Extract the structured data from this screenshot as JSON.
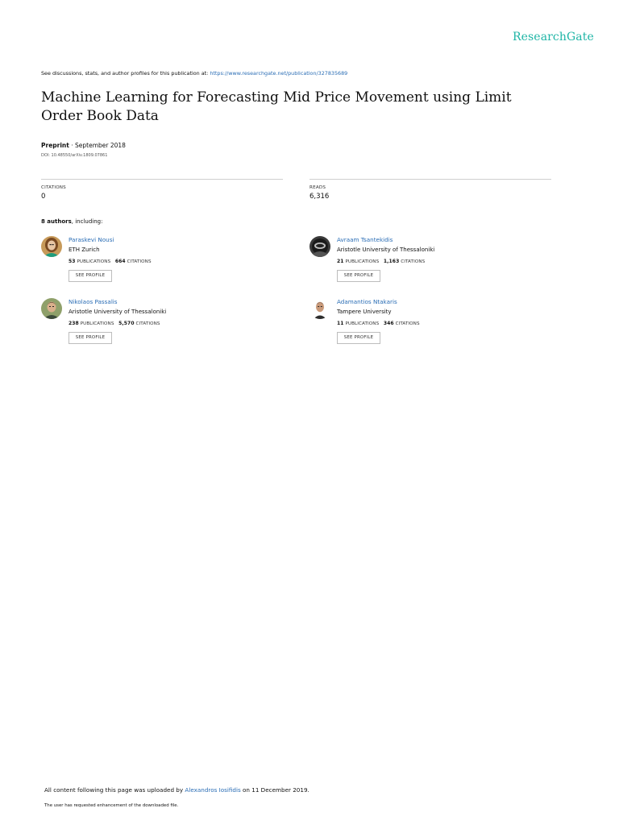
{
  "brand": {
    "logo_text": "ResearchGate",
    "accent": "#1fb5a6",
    "link_color": "#2a6db5"
  },
  "header": {
    "discussion_prefix": "See discussions, stats, and author profiles for this publication at: ",
    "discussion_url": "https://www.researchgate.net/publication/327835689"
  },
  "publication": {
    "title": "Machine Learning for Forecasting Mid Price Movement using Limit Order Book Data",
    "type": "Preprint",
    "date": " · September 2018",
    "doi": "DOI: 10.48550/arXiv.1809.07861"
  },
  "stats": {
    "citations_label": "CITATIONS",
    "citations_value": "0",
    "reads_label": "READS",
    "reads_value": "6,316"
  },
  "authors_section": {
    "count_text": "8 authors",
    "suffix": ", including:"
  },
  "authors": [
    {
      "name": "Paraskevi Nousi",
      "affiliation": "ETH Zurich",
      "publications": "53",
      "publications_label": " PUBLICATIONS",
      "citations": "664",
      "citations_label": " CITATIONS",
      "button": "SEE PROFILE",
      "avatar_icon": "woman-portrait"
    },
    {
      "name": "Avraam Tsantekidis",
      "affiliation": "Aristotle University of Thessaloniki",
      "publications": "21",
      "publications_label": " PUBLICATIONS",
      "citations": "1,163",
      "citations_label": " CITATIONS",
      "button": "SEE PROFILE",
      "avatar_icon": "helmet-portrait"
    },
    {
      "name": "Nikolaos Passalis",
      "affiliation": "Aristotle University of Thessaloniki",
      "publications": "238",
      "publications_label": " PUBLICATIONS",
      "citations": "5,570",
      "citations_label": " CITATIONS",
      "button": "SEE PROFILE",
      "avatar_icon": "man-portrait"
    },
    {
      "name": "Adamantios Ntakaris",
      "affiliation": "Tampere University",
      "publications": "11",
      "publications_label": " PUBLICATIONS",
      "citations": "346",
      "citations_label": " CITATIONS",
      "button": "SEE PROFILE",
      "avatar_icon": "man-portrait-white-bg"
    }
  ],
  "footer": {
    "upload_prefix": "All content following this page was uploaded by ",
    "uploader": "Alexandros Iosifidis",
    "upload_suffix": " on 11 December 2019.",
    "enhancement_note": "The user has requested enhancement of the downloaded file."
  }
}
